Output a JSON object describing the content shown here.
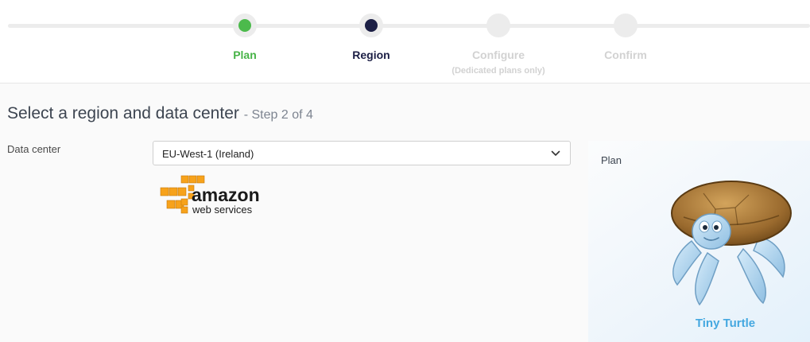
{
  "stepper": {
    "steps": [
      {
        "label": "Plan",
        "state": "done",
        "sublabel": ""
      },
      {
        "label": "Region",
        "state": "current",
        "sublabel": ""
      },
      {
        "label": "Configure",
        "state": "pending",
        "sublabel": "(Dedicated plans only)"
      },
      {
        "label": "Confirm",
        "state": "pending",
        "sublabel": ""
      }
    ],
    "colors": {
      "done": "#4cba4c",
      "current": "#1c1f45",
      "pending": "#d2d2d2"
    }
  },
  "main": {
    "title": "Select a region and data center",
    "step_indicator": "- Step 2 of 4"
  },
  "form": {
    "data_center_label": "Data center",
    "data_center_value": "EU-West-1 (Ireland)"
  },
  "provider_logo": {
    "icon": "aws-logo-icon",
    "wordmark": "amazon",
    "sub_wordmark": "web services",
    "colors": {
      "cubes": "#f7a21b",
      "text": "#1a1a1a"
    }
  },
  "plan_panel": {
    "title": "Plan",
    "plan_name": "Tiny Turtle",
    "icon": "turtle-icon",
    "accent": "#45a8e0"
  }
}
